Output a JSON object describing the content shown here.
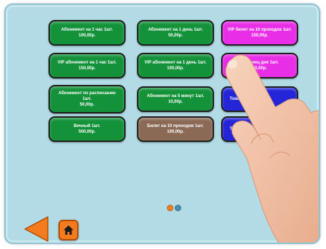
{
  "tiles": [
    {
      "id": "t1",
      "lines": [
        "Абонемент на 1 час 1шт.",
        "100,00р."
      ],
      "color": "#14923a"
    },
    {
      "id": "t2",
      "lines": [
        "Абонемент на 1 день 1шт.",
        "50,00р."
      ],
      "color": "#14923a"
    },
    {
      "id": "t3",
      "lines": [
        "VIP билет на 10 проходов 1шт.",
        "150,00р."
      ],
      "color": "#e82ee6"
    },
    {
      "id": "t4",
      "lines": [
        "VIP абонемент на 1 час 1шт.",
        "150,00р."
      ],
      "color": "#14923a"
    },
    {
      "id": "t5",
      "lines": [
        "VIP абонемент на 1 день 1шт.",
        "100,00р."
      ],
      "color": "#14923a"
    },
    {
      "id": "t6",
      "lines": [
        "На конец дня 1шт.",
        "50,00р."
      ],
      "color": "#e82ee6"
    },
    {
      "id": "t7",
      "lines": [
        "Абонемент по расписанию",
        "1шт.",
        "50,00р."
      ],
      "color": "#14923a"
    },
    {
      "id": "t8",
      "lines": [
        "Абонемент на 5 минут 1шт.",
        "10,00р."
      ],
      "color": "#14923a"
    },
    {
      "id": "t9",
      "lines": [
        "Товар"
      ],
      "color": "#2525d8"
    },
    {
      "id": "t10",
      "lines": [
        "Вечный 1шт.",
        "500,00р."
      ],
      "color": "#14923a"
    },
    {
      "id": "t11",
      "lines": [
        "Билет на 10 проходов 1шт.",
        "100,00р."
      ],
      "color": "#8b6a55"
    },
    {
      "id": "t12",
      "lines": [
        "Товар"
      ],
      "color": "#2525d8"
    }
  ],
  "pager": {
    "dots": 2,
    "active": 0,
    "active_color": "#f07d22",
    "inactive_color": "#4d8fb0"
  },
  "icons": {
    "next": "arrow-right-icon",
    "back": "arrow-left-icon",
    "home": "home-icon",
    "hand": "pointing-hand-image"
  },
  "colors": {
    "background": "#b2dbe5",
    "nav_arrow": "#f47c1f"
  }
}
